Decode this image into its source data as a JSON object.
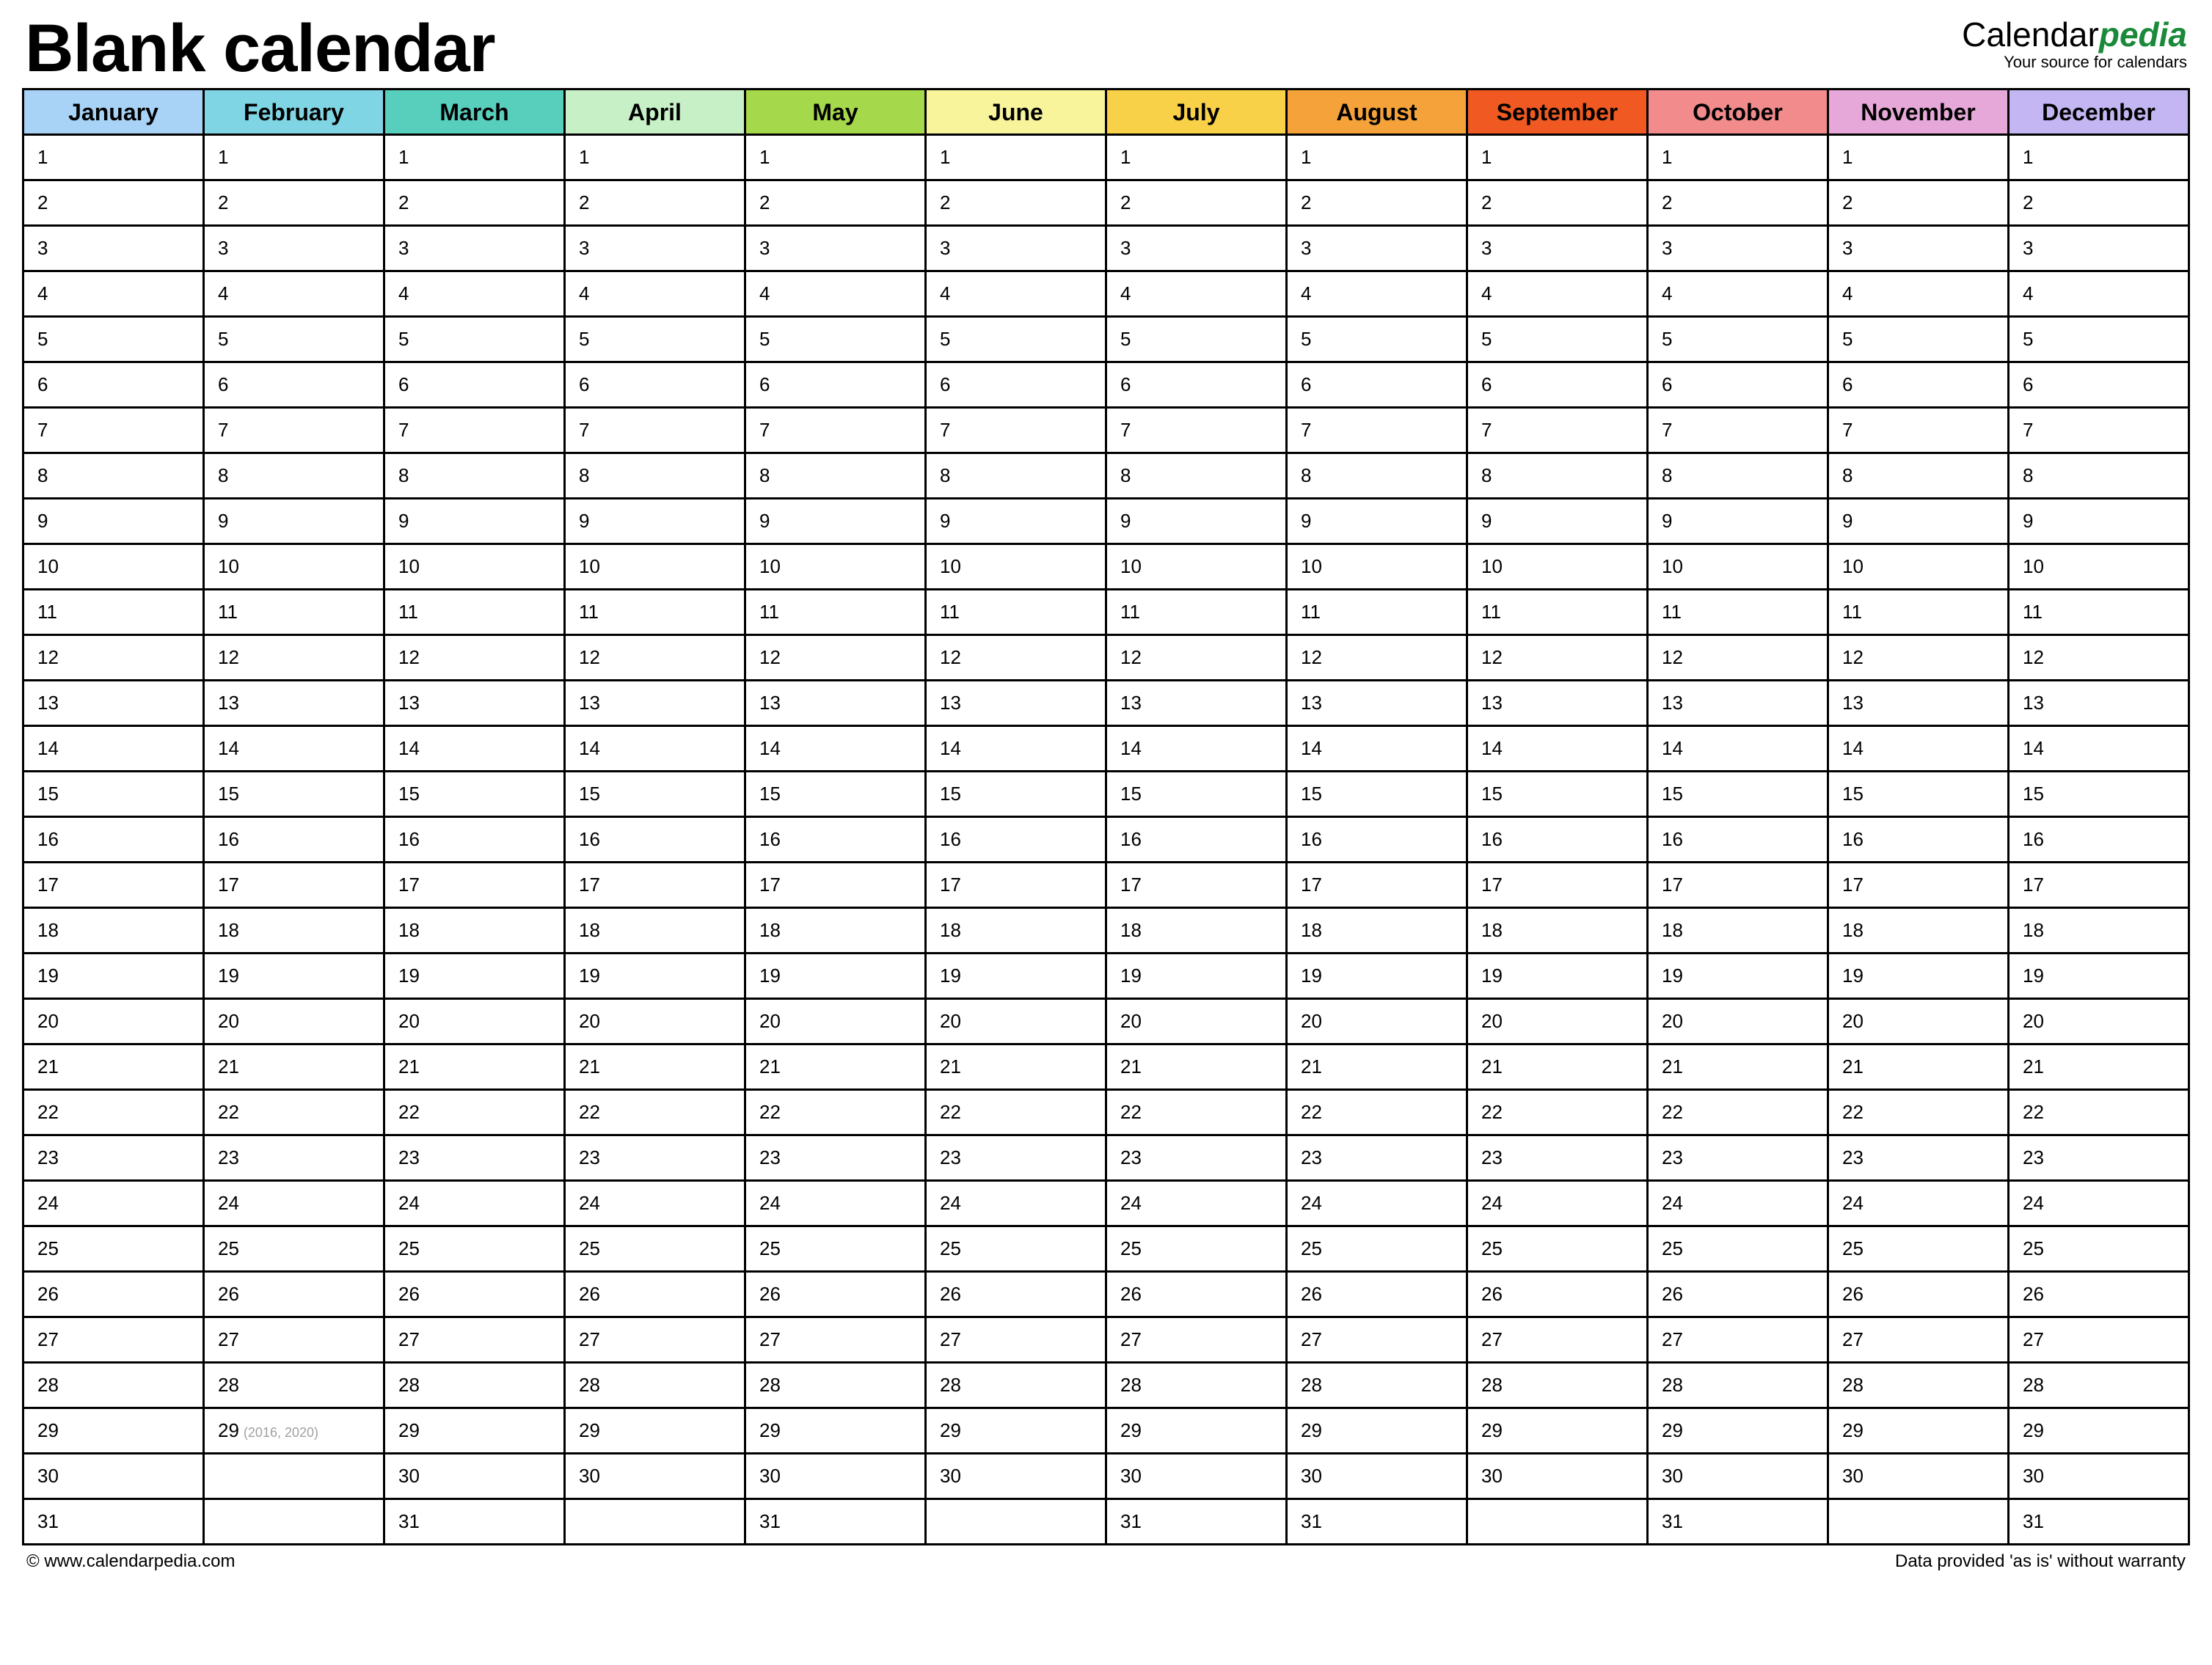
{
  "title": "Blank calendar",
  "brand": {
    "part1": "Calendar",
    "part2": "pedia",
    "tagline": "Your source for calendars"
  },
  "months": [
    {
      "name": "January",
      "color": "#a8d3f7",
      "days": 31
    },
    {
      "name": "February",
      "color": "#7fd5e3",
      "days": 29,
      "leap_day": 29,
      "leap_note": "(2016, 2020)"
    },
    {
      "name": "March",
      "color": "#58cfbd",
      "days": 31
    },
    {
      "name": "April",
      "color": "#c7f0c7",
      "days": 30
    },
    {
      "name": "May",
      "color": "#a5d84a",
      "days": 31
    },
    {
      "name": "June",
      "color": "#f8f49b",
      "days": 30
    },
    {
      "name": "July",
      "color": "#f9d149",
      "days": 31
    },
    {
      "name": "August",
      "color": "#f5a23a",
      "days": 31
    },
    {
      "name": "September",
      "color": "#f05a22",
      "days": 30
    },
    {
      "name": "October",
      "color": "#f28b8b",
      "days": 31
    },
    {
      "name": "November",
      "color": "#e6a8d8",
      "days": 30
    },
    {
      "name": "December",
      "color": "#c3b6f2",
      "days": 31
    }
  ],
  "max_rows": 31,
  "footer": {
    "left": "© www.calendarpedia.com",
    "right": "Data provided 'as is' without warranty"
  }
}
